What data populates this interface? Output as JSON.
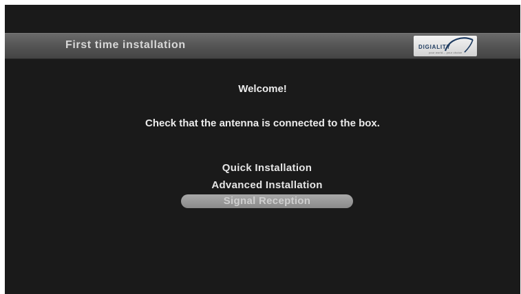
{
  "header": {
    "title": "First time installation",
    "brand": {
      "name": "DIGIALITY",
      "tagline": "your world... your choice"
    }
  },
  "main": {
    "welcome": "Welcome!",
    "message": "Check that the antenna is connected to the box.",
    "menu": [
      {
        "label": "Quick Installation",
        "selected": false
      },
      {
        "label": "Advanced Installation",
        "selected": false
      },
      {
        "label": "Signal Reception",
        "selected": true
      }
    ]
  },
  "colors": {
    "background": "#1a1a1a",
    "header_bar": "#565656",
    "selection": "#9a9a9a",
    "text": "#ececec"
  }
}
